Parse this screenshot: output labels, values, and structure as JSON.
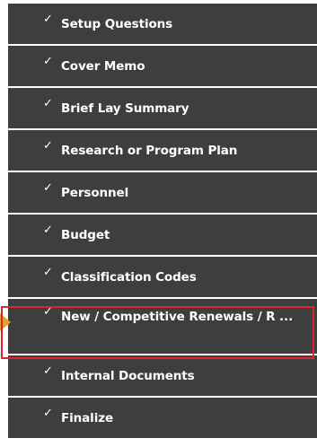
{
  "nav": {
    "items": [
      {
        "label": "Setup Questions",
        "check_icon": "checkmark-icon",
        "active": false
      },
      {
        "label": "Cover Memo",
        "check_icon": "checkmark-icon",
        "active": false
      },
      {
        "label": "Brief Lay Summary",
        "check_icon": "checkmark-icon",
        "active": false
      },
      {
        "label": "Research or Program Plan",
        "check_icon": "checkmark-icon",
        "active": false
      },
      {
        "label": "Personnel",
        "check_icon": "checkmark-icon",
        "active": false
      },
      {
        "label": "Budget",
        "check_icon": "checkmark-icon",
        "active": false
      },
      {
        "label": "Classification Codes",
        "check_icon": "checkmark-icon",
        "active": false
      },
      {
        "label": "New / Competitive Renewals / R ...",
        "check_icon": "checkmark-icon",
        "active": true
      },
      {
        "label": "Internal Documents",
        "check_icon": "checkmark-icon",
        "active": false
      },
      {
        "label": "Finalize",
        "check_icon": "checkmark-icon",
        "active": false
      }
    ],
    "check_glyph": "✓",
    "active_indicator_icon": "triangle-pointer-icon"
  },
  "colors": {
    "item_background": "#3e3e3e",
    "item_text": "#ffffff",
    "active_indicator": "#e2a42a",
    "highlight_border": "#e0242c"
  }
}
